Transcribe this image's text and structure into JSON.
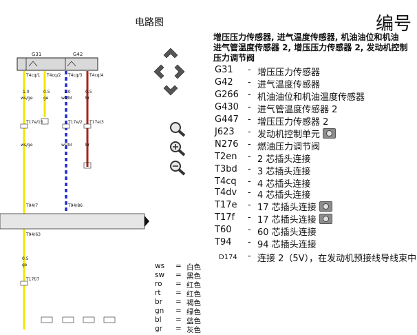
{
  "header": {
    "page_title": "电路图",
    "doc_number": "编号"
  },
  "legend": {
    "heading_line1": "增压压力传感器, 进气温度传感器, 机油油位和机油",
    "heading_line2": "进气管温度传感器 2, 增压压力传感器 2, 发动机控制",
    "heading_line3": "压力调节阀",
    "components": [
      {
        "code": "G31",
        "dash": "-",
        "desc": "增压压力传感器",
        "camera": false
      },
      {
        "code": "G42",
        "dash": "-",
        "desc": "进气温度传感器",
        "camera": false
      },
      {
        "code": "G266",
        "dash": "-",
        "desc": "机油油位和机油温度传感器",
        "camera": false
      },
      {
        "code": "G430",
        "dash": "-",
        "desc": "进气管温度传感器 2",
        "camera": false
      },
      {
        "code": "G447",
        "dash": "-",
        "desc": "增压压力传感器 2",
        "camera": false
      },
      {
        "code": "J623",
        "dash": "-",
        "desc": "发动机控制单元",
        "camera": true
      },
      {
        "code": "N276",
        "dash": "-",
        "desc": "燃油压力调节阀",
        "camera": false
      },
      {
        "code": "T2en",
        "dash": "-",
        "desc": "2 芯插头连接",
        "camera": false
      },
      {
        "code": "T3bd",
        "dash": "-",
        "desc": "3 芯插头连接",
        "camera": false
      },
      {
        "code": "T4cq",
        "dash": "-",
        "desc": "4 芯插头连接",
        "camera": false
      },
      {
        "code": "T4dv",
        "dash": "-",
        "desc": "4 芯插头连接",
        "camera": false
      },
      {
        "code": "T17e",
        "dash": "-",
        "desc": "17 芯插头连接",
        "camera": true
      },
      {
        "code": "T17f",
        "dash": "-",
        "desc": "17 芯插头连接",
        "camera": true
      },
      {
        "code": "T60",
        "dash": "-",
        "desc": "60 芯插头连接",
        "camera": false
      },
      {
        "code": "T94",
        "dash": "-",
        "desc": "94 芯插头连接",
        "camera": false
      },
      {
        "code": "D174",
        "dash": "-",
        "desc": "连接 2（5V），在发动机预接线导线束中",
        "camera": false
      }
    ]
  },
  "wire_colors": [
    {
      "code": "ws",
      "eq": "=",
      "name": "白色"
    },
    {
      "code": "sw",
      "eq": "=",
      "name": "黑色"
    },
    {
      "code": "ro",
      "eq": "=",
      "name": "红色"
    },
    {
      "code": "rt",
      "eq": "=",
      "name": "红色"
    },
    {
      "code": "br",
      "eq": "=",
      "name": "褐色"
    },
    {
      "code": "gn",
      "eq": "=",
      "name": "绿色"
    },
    {
      "code": "bl",
      "eq": "=",
      "name": "蓝色"
    },
    {
      "code": "gr",
      "eq": "=",
      "name": "灰色"
    }
  ],
  "diagram": {
    "comp_left": "G31",
    "comp_right": "G42",
    "wires": [
      {
        "pin": "T4cq/1",
        "size": "1.0",
        "color": "ws/ge",
        "conn": "T17e/15",
        "color2": "ws/ge",
        "t94": "T94/7",
        "hex": "#f2e600"
      },
      {
        "pin": "T4cq/2",
        "size": "0.5",
        "color": "ge",
        "conn": "",
        "color2": "",
        "t94": "",
        "hex": "#f2e600"
      },
      {
        "pin": "T4cq/3",
        "size": "1.0",
        "color": "ws/bl",
        "conn": "T17e/2",
        "color2": "ws/bl",
        "t94": "T94/86",
        "hex": "#1e2bd6"
      },
      {
        "pin": "T4cq/4",
        "size": "0.5",
        "color": "br",
        "conn": "T17e/3",
        "color2": "br",
        "t94": "",
        "hex": "#a5261e"
      }
    ],
    "lower": {
      "t94": "T94/63",
      "size": "0.5",
      "color": "ge",
      "conn": "T17f/7"
    }
  },
  "colors": {
    "yellow": "#f2e600",
    "blue": "#1e2bd6",
    "brown": "#a5261e",
    "band": "#e6e6e6",
    "component_fill": "#d9d9d9"
  }
}
